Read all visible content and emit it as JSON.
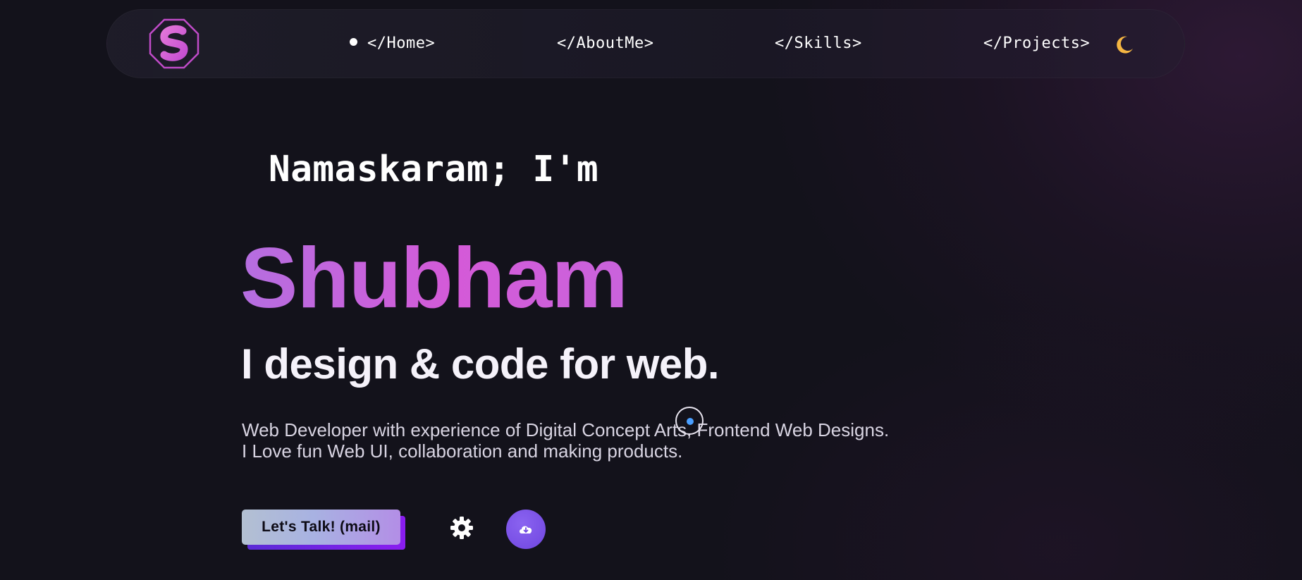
{
  "nav": {
    "items": [
      {
        "label": "</Home>",
        "active": true
      },
      {
        "label": "</AboutMe>",
        "active": false
      },
      {
        "label": "</Skills>",
        "active": false
      },
      {
        "label": "</Projects>",
        "active": false
      }
    ],
    "logo_icon": "s-octagon-logo",
    "theme_icon": "moon-icon"
  },
  "hero": {
    "greeting": "Namaskaram; I'm",
    "name": "Shubham",
    "tagline": "I design & code for web.",
    "description": "Web Developer with experience of Digital Concept Arts, Frontend Web Designs. I Love fun Web UI, collaboration and making products."
  },
  "actions": {
    "talk_label": "Let's Talk! (mail)",
    "settings_icon": "gear-icon",
    "download_icon": "cloud-download-icon"
  },
  "colors": {
    "background": "#13121b",
    "accent_name_gradient": [
      "#b56ee0",
      "#d45ad8"
    ],
    "moon": "#f5b642",
    "download_button": "#7b52e8",
    "logo_stroke": "#c04bc8"
  }
}
